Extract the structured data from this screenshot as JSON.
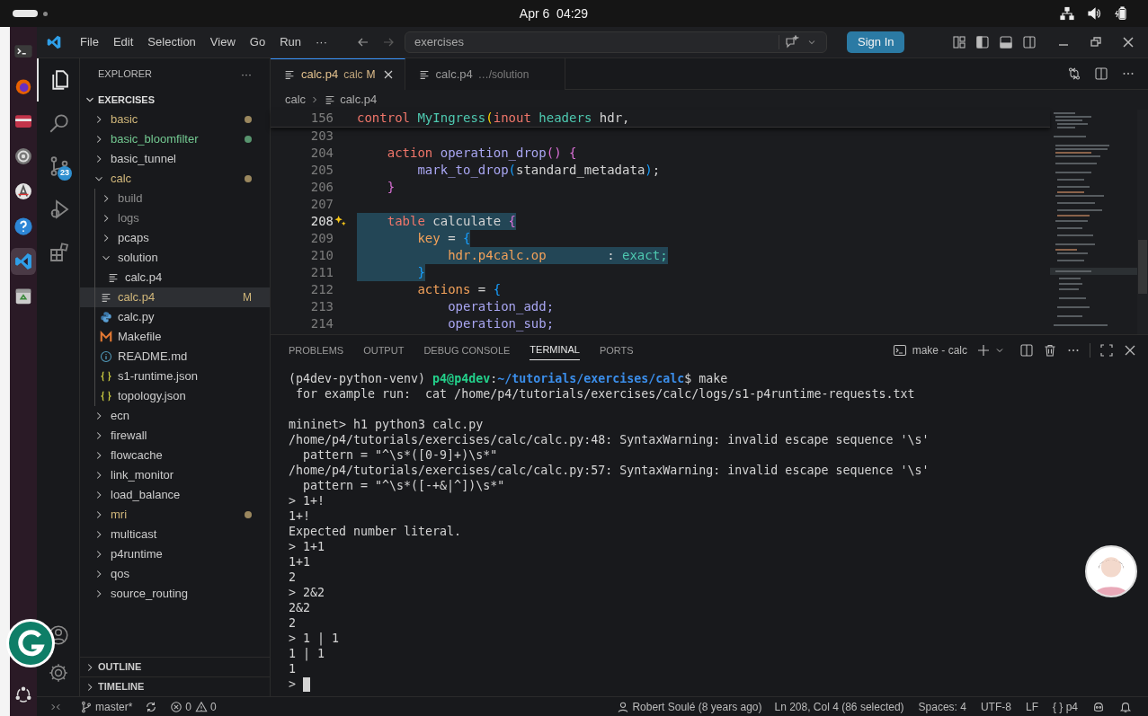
{
  "top_bar": {
    "clock": "Apr 6  04:29"
  },
  "dock": {
    "items": [
      {
        "kind": "terminal",
        "selected": false
      },
      {
        "kind": "browser",
        "selected": false
      },
      {
        "kind": "folder",
        "selected": false
      },
      {
        "kind": "settings",
        "selected": false
      },
      {
        "kind": "updater",
        "selected": false
      },
      {
        "kind": "help",
        "selected": false
      },
      {
        "kind": "editor",
        "selected": true
      },
      {
        "kind": "trash",
        "selected": false
      }
    ]
  },
  "menu": [
    "File",
    "Edit",
    "Selection",
    "View",
    "Go",
    "Run",
    "···"
  ],
  "command_center": {
    "title": "exercises"
  },
  "sign_in": "Sign In",
  "activity_bar": [
    {
      "kind": "explorer",
      "selected": true
    },
    {
      "kind": "search",
      "selected": false
    },
    {
      "kind": "scm",
      "selected": false,
      "badge": "23"
    },
    {
      "kind": "debug",
      "selected": false
    },
    {
      "kind": "extensions",
      "selected": false
    }
  ],
  "explorer": {
    "title": "EXPLORER",
    "more": "···",
    "root": "EXERCISES",
    "tree": [
      {
        "label": "basic",
        "kind": "folder",
        "expanded": false,
        "color": "#d1b77a",
        "dot": true,
        "selected": false
      },
      {
        "label": "basic_bloomfilter",
        "kind": "folder",
        "expanded": false,
        "color": "#73c991",
        "dot": true,
        "selected": false
      },
      {
        "label": "basic_tunnel",
        "kind": "folder",
        "expanded": false,
        "selected": false
      },
      {
        "label": "calc",
        "kind": "folder",
        "expanded": true,
        "color": "#d1b77a",
        "dot": true,
        "selected": false,
        "children": [
          {
            "label": "build",
            "kind": "folder",
            "expanded": false,
            "color": "#8c8c8c",
            "selected": false
          },
          {
            "label": "logs",
            "kind": "folder",
            "expanded": false,
            "color": "#8c8c8c",
            "selected": false
          },
          {
            "label": "pcaps",
            "kind": "folder",
            "expanded": false,
            "selected": false
          },
          {
            "label": "solution",
            "kind": "folder",
            "expanded": true,
            "selected": false,
            "children": [
              {
                "label": "calc.p4",
                "kind": "text",
                "selected": false
              }
            ]
          },
          {
            "label": "calc.p4",
            "kind": "text",
            "color": "#d1b77a",
            "badge": "M",
            "selected": true
          },
          {
            "label": "calc.py",
            "kind": "python",
            "selected": false
          },
          {
            "label": "Makefile",
            "kind": "makefile",
            "selected": false
          },
          {
            "label": "README.md",
            "kind": "info",
            "selected": false
          },
          {
            "label": "s1-runtime.json",
            "kind": "json",
            "selected": false
          },
          {
            "label": "topology.json",
            "kind": "json",
            "selected": false
          }
        ]
      },
      {
        "label": "ecn",
        "kind": "folder",
        "expanded": false,
        "selected": false
      },
      {
        "label": "firewall",
        "kind": "folder",
        "expanded": false,
        "selected": false
      },
      {
        "label": "flowcache",
        "kind": "folder",
        "expanded": false,
        "selected": false
      },
      {
        "label": "link_monitor",
        "kind": "folder",
        "expanded": false,
        "selected": false
      },
      {
        "label": "load_balance",
        "kind": "folder",
        "expanded": false,
        "selected": false
      },
      {
        "label": "mri",
        "kind": "folder",
        "expanded": false,
        "color": "#d1b77a",
        "dot": true,
        "selected": false
      },
      {
        "label": "multicast",
        "kind": "folder",
        "expanded": false,
        "selected": false
      },
      {
        "label": "p4runtime",
        "kind": "folder",
        "expanded": false,
        "selected": false
      },
      {
        "label": "qos",
        "kind": "folder",
        "expanded": false,
        "selected": false
      },
      {
        "label": "source_routing",
        "kind": "folder",
        "expanded": false,
        "selected": false
      }
    ],
    "sections": [
      {
        "label": "OUTLINE",
        "expanded": false
      },
      {
        "label": "TIMELINE",
        "expanded": false
      }
    ]
  },
  "tabs": [
    {
      "label": "calc.p4",
      "description": "calc",
      "decoration": "M",
      "selected": true
    },
    {
      "label": "calc.p4",
      "description": "…/solution",
      "selected": false
    }
  ],
  "breadcrumb": [
    "calc",
    "calc.p4"
  ],
  "editor": {
    "sticky_line": {
      "number": "156",
      "tokens": [
        {
          "text": "control",
          "kind": "kw"
        },
        {
          "text": " MyIngress",
          "kind": "type"
        },
        {
          "text": "(",
          "kind": "b1"
        },
        {
          "text": "inout",
          "kind": "kw"
        },
        {
          "text": " headers",
          "kind": "type"
        },
        {
          "text": " hdr,",
          "kind": "plain"
        }
      ]
    },
    "lines": [
      {
        "number": "203"
      },
      {
        "number": "204",
        "selected": false,
        "current": false,
        "tokens": [
          {
            "text": "    action",
            "kind": "kw"
          },
          {
            "text": " operation_drop",
            "kind": "fn"
          },
          {
            "text": "()",
            "kind": "b2"
          },
          {
            "text": " {",
            "kind": "b2"
          }
        ]
      },
      {
        "number": "205",
        "selected": false,
        "current": false,
        "tokens": [
          {
            "text": "        mark_to_drop",
            "kind": "fn"
          },
          {
            "text": "(",
            "kind": "b3"
          },
          {
            "text": "standard_metadata",
            "kind": "plain"
          },
          {
            "text": ")",
            "kind": "b3"
          },
          {
            "text": ";",
            "kind": "plain"
          }
        ]
      },
      {
        "number": "206",
        "selected": false,
        "current": false,
        "tokens": [
          {
            "text": "    }",
            "kind": "b2"
          }
        ]
      },
      {
        "number": "207"
      },
      {
        "number": "208",
        "selected": true,
        "current": true,
        "hint": true,
        "tokens": [
          {
            "text": "    table",
            "kind": "kw"
          },
          {
            "text": " calculate",
            "kind": "plain"
          },
          {
            "text": " {",
            "kind": "b2"
          }
        ]
      },
      {
        "number": "209",
        "selected": true,
        "current": false,
        "tokens": [
          {
            "text": "        key",
            "kind": "field"
          },
          {
            "text": " =",
            "kind": "plain"
          },
          {
            "text": " {",
            "kind": "b3"
          }
        ]
      },
      {
        "number": "210",
        "selected": true,
        "current": false,
        "tokens": [
          {
            "text": "            hdr.p4calc.op",
            "kind": "field"
          },
          {
            "text": "        :",
            "kind": "plain"
          },
          {
            "text": " exact;",
            "kind": "type"
          }
        ]
      },
      {
        "number": "211",
        "selected": true,
        "current": false,
        "tokens": [
          {
            "text": "        }",
            "kind": "b3"
          }
        ]
      },
      {
        "number": "212",
        "selected": false,
        "current": false,
        "tokens": [
          {
            "text": "        actions",
            "kind": "field"
          },
          {
            "text": " =",
            "kind": "plain"
          },
          {
            "text": " {",
            "kind": "b3"
          }
        ]
      },
      {
        "number": "213",
        "selected": false,
        "current": false,
        "tokens": [
          {
            "text": "            operation_add;",
            "kind": "fn"
          }
        ]
      },
      {
        "number": "214",
        "selected": false,
        "current": false,
        "tokens": [
          {
            "text": "            operation_sub;",
            "kind": "fn"
          }
        ]
      }
    ]
  },
  "panel": {
    "tabs": [
      {
        "label": "PROBLEMS",
        "selected": false
      },
      {
        "label": "OUTPUT",
        "selected": false
      },
      {
        "label": "DEBUG CONSOLE",
        "selected": false
      },
      {
        "label": "TERMINAL",
        "selected": true
      },
      {
        "label": "PORTS",
        "selected": false
      }
    ],
    "terminal_name": "make - calc"
  },
  "terminal": [
    {
      "segments": [
        {
          "text": "(p4dev-python-venv) ",
          "kind": "plain"
        },
        {
          "text": "p4@p4dev",
          "kind": "user"
        },
        {
          "text": ":",
          "kind": "plain"
        },
        {
          "text": "~/tutorials/exercises/calc",
          "kind": "path"
        },
        {
          "text": "$ make",
          "kind": "plain"
        }
      ]
    },
    {
      "segments": [
        {
          "text": " for example run:  cat /home/p4/tutorials/exercises/calc/logs/s1-p4runtime-requests.txt",
          "kind": "plain"
        }
      ]
    },
    {
      "gap_before": true,
      "segments": [
        {
          "text": "mininet> h1 python3 calc.py",
          "kind": "plain"
        }
      ]
    },
    {
      "segments": [
        {
          "text": "/home/p4/tutorials/exercises/calc/calc.py:48: SyntaxWarning: invalid escape sequence '\\s'",
          "kind": "plain"
        }
      ]
    },
    {
      "segments": [
        {
          "text": "  pattern = \"^\\s*([0-9]+)\\s*\"",
          "kind": "plain"
        }
      ]
    },
    {
      "segments": [
        {
          "text": "/home/p4/tutorials/exercises/calc/calc.py:57: SyntaxWarning: invalid escape sequence '\\s'",
          "kind": "plain"
        }
      ]
    },
    {
      "segments": [
        {
          "text": "  pattern = \"^\\s*([-+&|^])\\s*\"",
          "kind": "plain"
        }
      ]
    },
    {
      "segments": [
        {
          "text": "> 1+!",
          "kind": "plain"
        }
      ]
    },
    {
      "segments": [
        {
          "text": "1+!",
          "kind": "plain"
        }
      ]
    },
    {
      "segments": [
        {
          "text": "Expected number literal.",
          "kind": "plain"
        }
      ]
    },
    {
      "segments": [
        {
          "text": "> 1+1",
          "kind": "plain"
        }
      ]
    },
    {
      "segments": [
        {
          "text": "1+1",
          "kind": "plain"
        }
      ]
    },
    {
      "segments": [
        {
          "text": "2",
          "kind": "plain"
        }
      ]
    },
    {
      "segments": [
        {
          "text": "> 2&2",
          "kind": "plain"
        }
      ]
    },
    {
      "segments": [
        {
          "text": "2&2",
          "kind": "plain"
        }
      ]
    },
    {
      "segments": [
        {
          "text": "2",
          "kind": "plain"
        }
      ]
    },
    {
      "segments": [
        {
          "text": "> 1 | 1",
          "kind": "plain"
        }
      ]
    },
    {
      "segments": [
        {
          "text": "1 | 1",
          "kind": "plain"
        }
      ]
    },
    {
      "segments": [
        {
          "text": "1",
          "kind": "plain"
        }
      ]
    },
    {
      "cursor": true,
      "segments": [
        {
          "text": "> ",
          "kind": "plain"
        }
      ]
    }
  ],
  "status_bar": {
    "left": [
      {
        "kind": "remote"
      },
      {
        "kind": "branch",
        "text": "master*"
      },
      {
        "kind": "sync"
      },
      {
        "kind": "errors",
        "text": "0"
      },
      {
        "kind": "warnings",
        "text": "0"
      }
    ],
    "right": [
      {
        "kind": "blame",
        "text": "Robert Soulé (8 years ago)"
      },
      {
        "kind": "text",
        "text": "Ln 208, Col 4 (86 selected)"
      },
      {
        "kind": "text",
        "text": "Spaces: 4"
      },
      {
        "kind": "text",
        "text": "UTF-8"
      },
      {
        "kind": "text",
        "text": "LF"
      },
      {
        "kind": "text",
        "text": "{ } p4"
      },
      {
        "kind": "copilot"
      },
      {
        "kind": "bell"
      }
    ]
  }
}
